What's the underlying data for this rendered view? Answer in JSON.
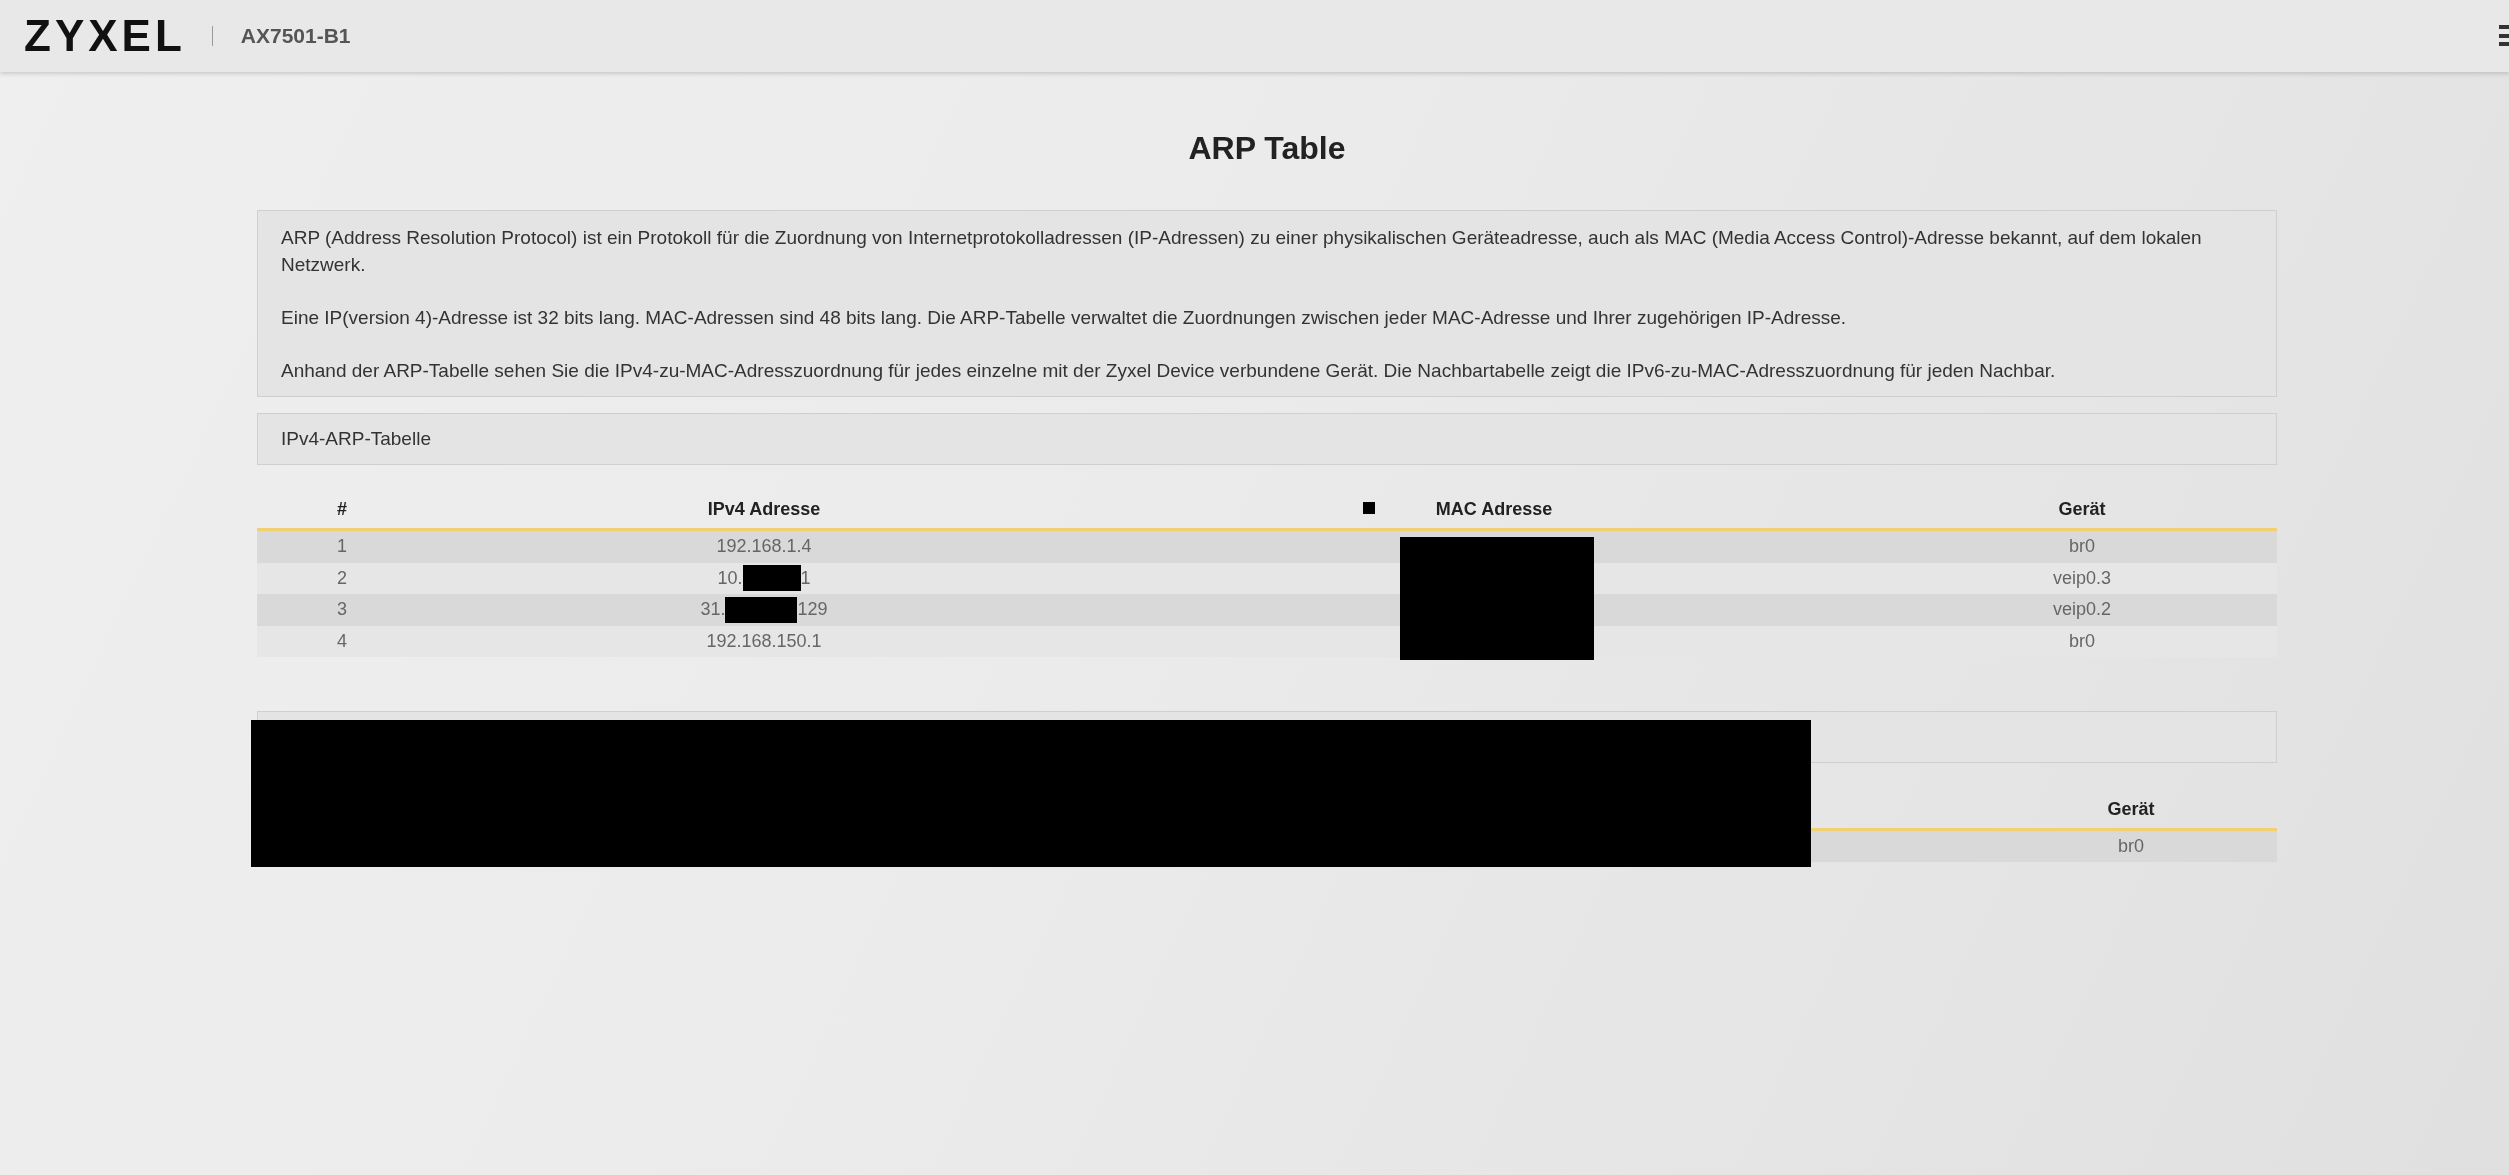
{
  "header": {
    "logo": "ZYXEL",
    "model": "AX7501-B1"
  },
  "title": "ARP Table",
  "description": [
    "ARP (Address Resolution Protocol) ist ein Protokoll für die Zuordnung von Internetprotokolladressen (IP-Adressen) zu einer physikalischen Geräteadresse, auch als MAC (Media Access Control)-Adresse bekannt, auf dem lokalen Netzwerk.",
    "Eine IP(version 4)-Adresse ist 32 bits lang. MAC-Adressen sind 48 bits lang. Die ARP-Tabelle verwaltet die Zuordnungen zwischen jeder MAC-Adresse und Ihrer zugehörigen IP-Adresse.",
    "Anhand der ARP-Tabelle sehen Sie die IPv4-zu-MAC-Adresszuordnung für jedes einzelne mit der Zyxel Device verbundene Gerät. Die Nachbartabelle zeigt die IPv6-zu-MAC-Adresszuordnung für jeden Nachbar."
  ],
  "ipv4_table": {
    "section_title": "IPv4-ARP-Tabelle",
    "columns": [
      "#",
      "IPv4 Adresse",
      "MAC Adresse",
      "Gerät"
    ],
    "rows": [
      {
        "index": "1",
        "ipv4": [
          "192.168.1.4"
        ],
        "device": "br0"
      },
      {
        "index": "2",
        "ipv4": [
          "10.",
          "1"
        ],
        "device": "veip0.3"
      },
      {
        "index": "3",
        "ipv4": [
          "31.",
          "129"
        ],
        "device": "veip0.2"
      },
      {
        "index": "4",
        "ipv4": [
          "192.168.150.1"
        ],
        "device": "br0"
      }
    ]
  },
  "neighbor_table": {
    "columns": [
      "Gerät"
    ],
    "rows": [
      {
        "device": "br0"
      }
    ]
  }
}
